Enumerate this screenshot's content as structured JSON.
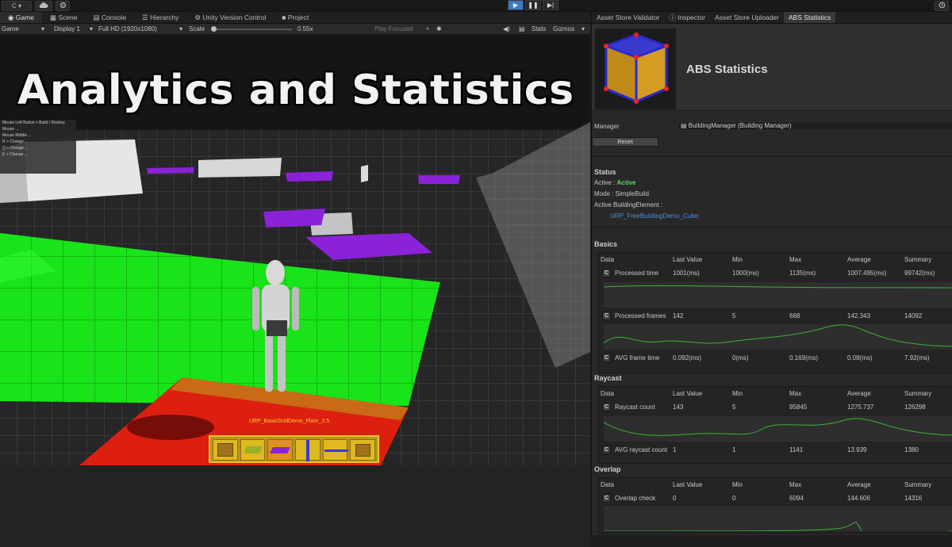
{
  "topbar": {
    "account_label": "C ▾",
    "play_icons": [
      "▶",
      "❚❚",
      "▶|"
    ]
  },
  "left_tabs": [
    "Game",
    "Scene",
    "Console",
    "Hierarchy",
    "Unity Version Control",
    "Project"
  ],
  "gamebar": {
    "game_select": "Game",
    "display": "Display 1",
    "resolution": "Full HD (1920x1080)",
    "scale_label": "Scale",
    "scale_value": "0.55x",
    "play_mode": "Play Focused",
    "stats": "Stats",
    "gizmos": "Gizmos"
  },
  "viewport": {
    "title": "Analytics and Statistics",
    "overlay_lines": [
      "Mouse Left Button > Build / Destroy",
      "Mouse ...",
      "Mouse Middle ...",
      "R > Change ...",
      "Q > Change ...",
      "E > Change ..."
    ],
    "floor_label": "URP_BasicGridDemo_Floor_2.5"
  },
  "right_tabs": [
    "Asset Store Validator",
    "Inspector",
    "Asset Store Uploader",
    "ABS Statistics"
  ],
  "inspector": {
    "title": "ABS Statistics",
    "manager_label": "Manager",
    "manager_value": "BuildingManager (Building Manager)",
    "reset": "Reset",
    "status_title": "Status",
    "active_label": "Active :",
    "active_value": "Active",
    "mode_label": "Mode : SimpleBuild",
    "element_label": "Active BuildingElement :",
    "element_value": "URP_FreeBuildingDemo_Cube"
  },
  "columns": [
    "Data",
    "Last Value",
    "Min",
    "Max",
    "Average",
    "Summary"
  ],
  "sections": [
    {
      "title": "Basics",
      "rows": [
        {
          "name": "Processed time",
          "last": "1001(ms)",
          "min": "1000(ms)",
          "max": "1135(ms)",
          "avg": "1007.495(ms)",
          "sum": "99742(ms)"
        },
        {
          "name": "Processed frames",
          "last": "142",
          "min": "5",
          "max": "668",
          "avg": "142.343",
          "sum": "14092"
        },
        {
          "name": "AVG frame time",
          "last": "0.092(ms)",
          "min": "0(ms)",
          "max": "0.169(ms)",
          "avg": "0.08(ms)",
          "sum": "7.92(ms)"
        }
      ]
    },
    {
      "title": "Raycast",
      "rows": [
        {
          "name": "Raycast count",
          "last": "143",
          "min": "5",
          "max": "95845",
          "avg": "1275.737",
          "sum": "126298"
        },
        {
          "name": "AVG raycast count",
          "last": "1",
          "min": "1",
          "max": "1141",
          "avg": "13.939",
          "sum": "1380"
        }
      ]
    },
    {
      "title": "Overlap",
      "rows": [
        {
          "name": "Overlap check",
          "last": "0",
          "min": "0",
          "max": "6094",
          "avg": "144.606",
          "sum": "14316"
        }
      ]
    }
  ]
}
